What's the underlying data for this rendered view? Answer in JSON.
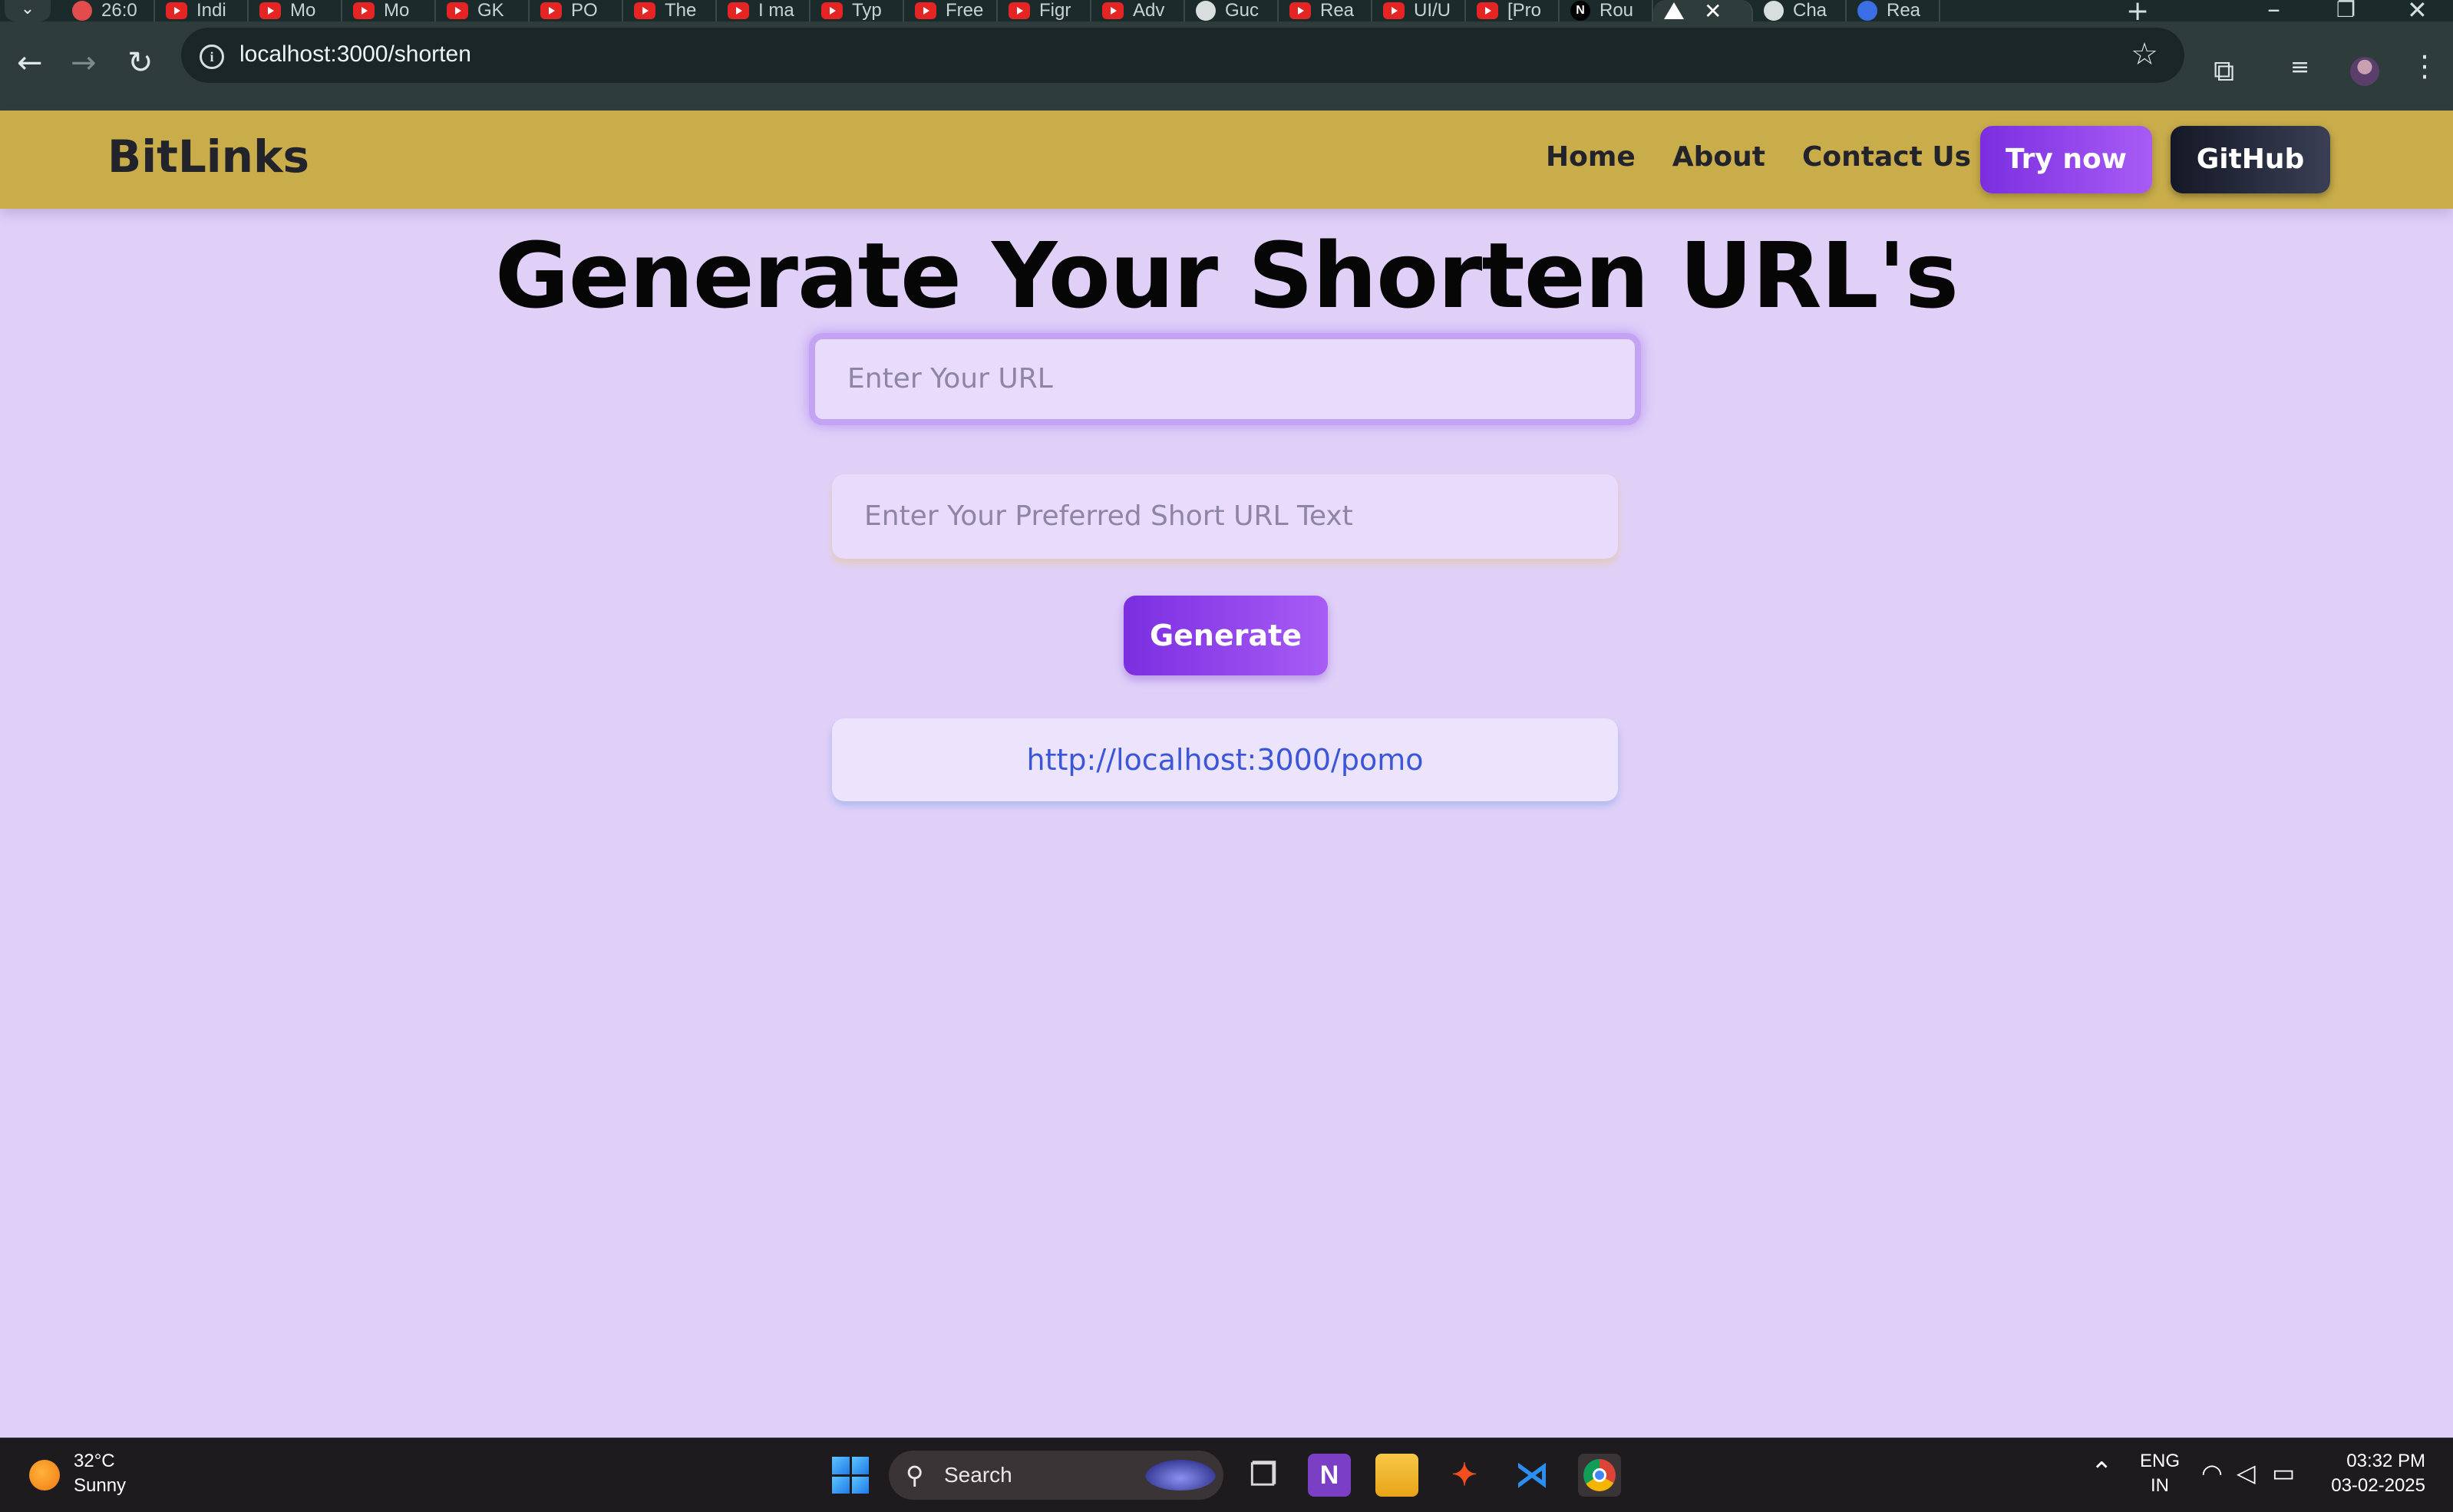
{
  "browser": {
    "tabs": [
      {
        "title": "26:0",
        "icon": "check-icon"
      },
      {
        "title": "Indi",
        "icon": "youtube-icon"
      },
      {
        "title": "Mo",
        "icon": "youtube-icon"
      },
      {
        "title": "Mo",
        "icon": "youtube-icon"
      },
      {
        "title": "GK",
        "icon": "youtube-icon"
      },
      {
        "title": "PO",
        "icon": "youtube-icon"
      },
      {
        "title": "The",
        "icon": "youtube-icon"
      },
      {
        "title": "I ma",
        "icon": "youtube-icon"
      },
      {
        "title": "Typ",
        "icon": "youtube-icon"
      },
      {
        "title": "Free",
        "icon": "youtube-icon"
      },
      {
        "title": "Figr",
        "icon": "youtube-icon"
      },
      {
        "title": "Adv",
        "icon": "youtube-icon"
      },
      {
        "title": "Guc",
        "icon": "chatgpt-icon"
      },
      {
        "title": "Rea",
        "icon": "youtube-icon"
      },
      {
        "title": "UI/U",
        "icon": "youtube-icon"
      },
      {
        "title": "[Pro",
        "icon": "youtube-icon"
      },
      {
        "title": "Rou",
        "icon": "nextjs-icon"
      },
      {
        "title": "",
        "icon": "vercel-icon",
        "active": true
      },
      {
        "title": "Cha",
        "icon": "chatgpt-icon"
      },
      {
        "title": "Rea",
        "icon": "react-icon"
      }
    ],
    "url": "localhost:3000/shorten"
  },
  "site": {
    "brand": "BitLinks",
    "nav": {
      "home": "Home",
      "about": "About",
      "contact": "Contact Us"
    },
    "try_now": "Try now",
    "github": "GitHub",
    "title": "Generate Your Shorten URL's",
    "url_placeholder": "Enter Your URL",
    "short_placeholder": "Enter Your Preferred Short URL Text",
    "generate": "Generate",
    "result_url": "http://localhost:3000/pomo"
  },
  "taskbar": {
    "weather_temp": "32°C",
    "weather_desc": "Sunny",
    "search_label": "Search",
    "lang_top": "ENG",
    "lang_bottom": "IN",
    "time": "03:32 PM",
    "date": "03-02-2025"
  },
  "colors": {
    "header_bg": "#c9ad4b",
    "page_bg": "#e0d0f8",
    "accent_purple": "#7b2ee0",
    "link_blue": "#3b56d8"
  }
}
